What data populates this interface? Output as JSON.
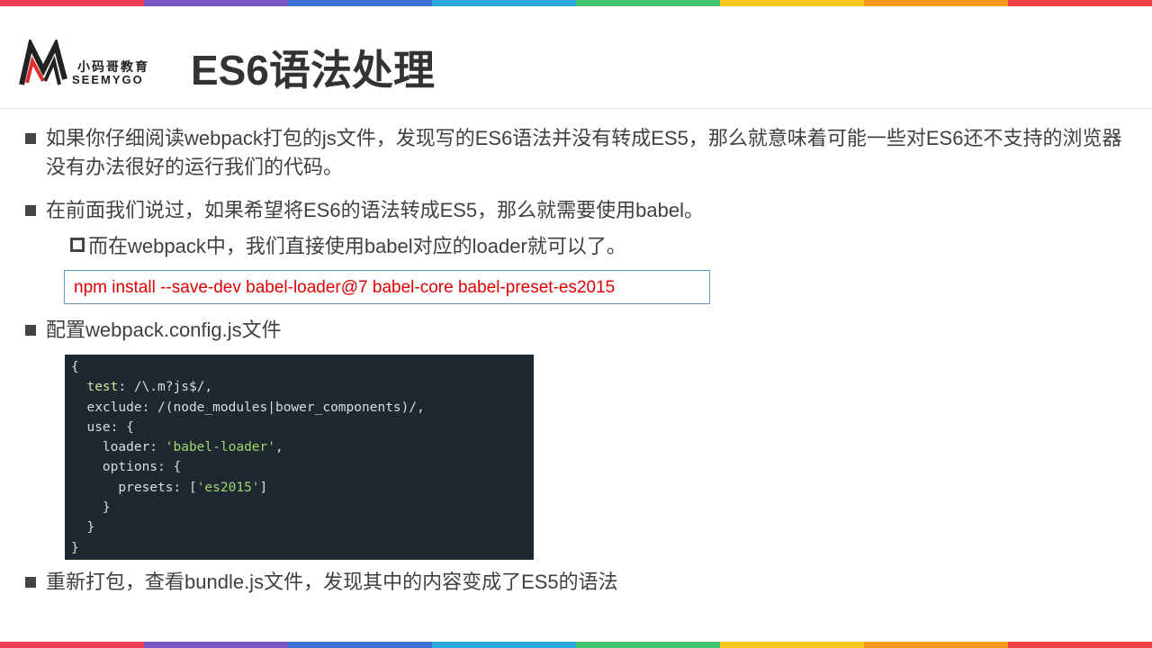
{
  "colors": {
    "stripe": [
      "#ef3d5a",
      "#7a57c8",
      "#3e73d4",
      "#29a8d9",
      "#44c56f",
      "#f6c619",
      "#f39a1d",
      "#ef4445"
    ],
    "title": "#333333",
    "text": "#404040",
    "command": "#e00000",
    "command_border": "#5b9bd5",
    "code_bg": "#1f2731",
    "code_string": "#9fd86a"
  },
  "logo": {
    "cn": "小码哥教育",
    "en": "SEEMYGO",
    "icon": "seemygo-m-logo-icon"
  },
  "title": "ES6语法处理",
  "bullets": [
    "如果你仔细阅读webpack打包的js文件，发现写的ES6语法并没有转成ES5，那么就意味着可能一些对ES6还不支持的浏览器没有办法很好的运行我们的代码。",
    "在前面我们说过，如果希望将ES6的语法转成ES5，那么就需要使用babel。",
    "配置webpack.config.js文件",
    "重新打包，查看bundle.js文件，发现其中的内容变成了ES5的语法"
  ],
  "sub_bullet": "而在webpack中，我们直接使用babel对应的loader就可以了。",
  "command": "npm install --save-dev babel-loader@7 babel-core babel-preset-es2015",
  "code": {
    "l1": "{",
    "l2a": "  ",
    "l2key": "test",
    "l2b": ": /\\.m?js$/,",
    "l3": "  exclude: /(node_modules|bower_components)/,",
    "l4": "  use: {",
    "l5a": "    loader: ",
    "l5str": "'babel-loader'",
    "l5b": ",",
    "l6": "    options: {",
    "l7a": "      presets: [",
    "l7str": "'es2015'",
    "l7b": "]",
    "l8": "    }",
    "l9": "  }",
    "l10": "}"
  }
}
